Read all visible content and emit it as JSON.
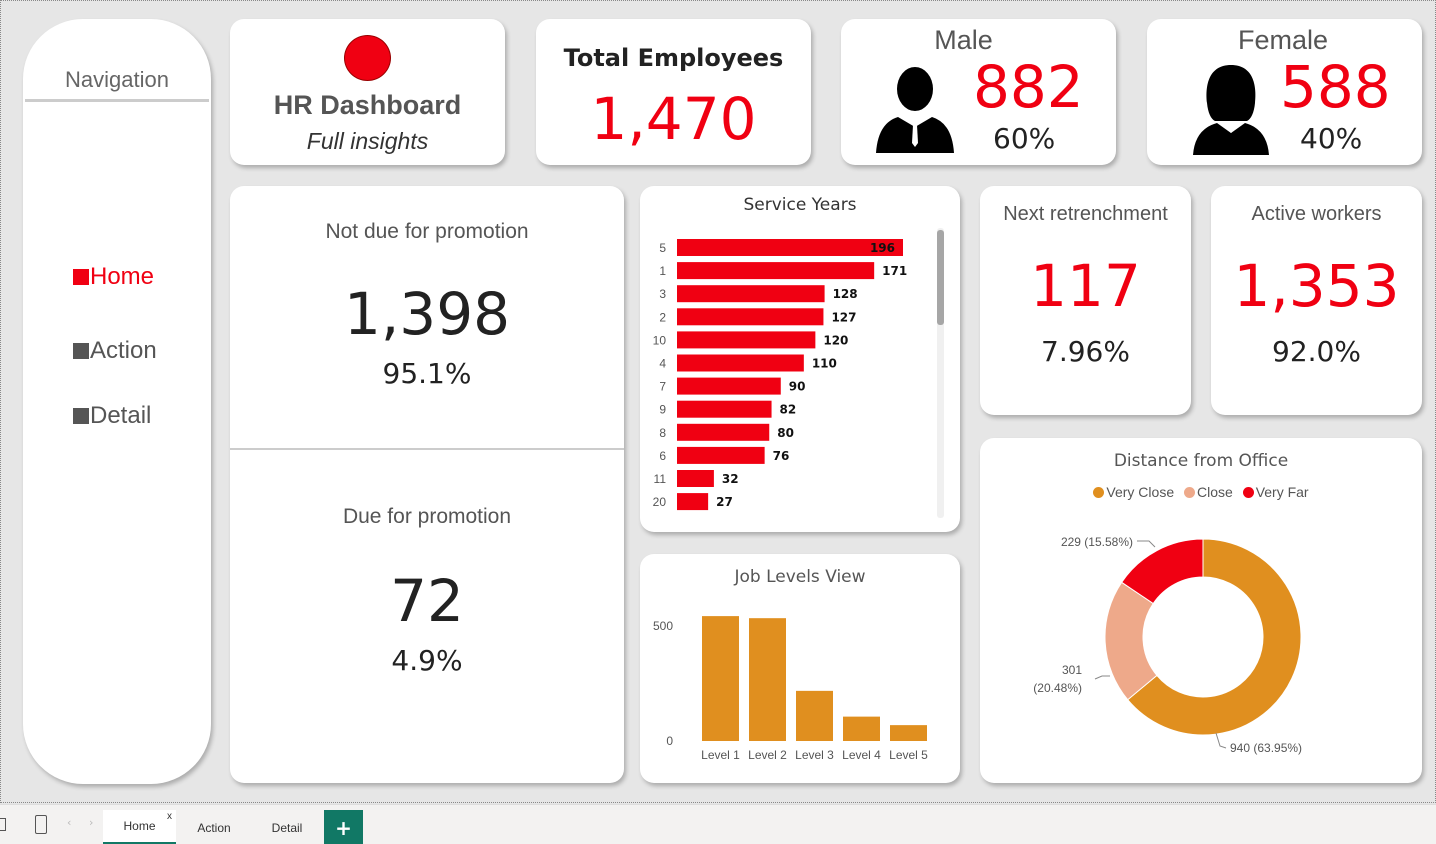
{
  "nav": {
    "title": "Navigation",
    "items": [
      {
        "label": "Home"
      },
      {
        "label": "Action"
      },
      {
        "label": "Detail"
      }
    ]
  },
  "hr": {
    "title": "HR Dashboard",
    "subtitle": "Full insights"
  },
  "total": {
    "title": "Total Employees",
    "value": "1,470"
  },
  "male": {
    "title": "Male",
    "value": "882",
    "pct": "60%"
  },
  "female": {
    "title": "Female",
    "value": "588",
    "pct": "40%"
  },
  "not_due": {
    "title": "Not due for promotion",
    "value": "1,398",
    "pct": "95.1%"
  },
  "due": {
    "title": "Due for promotion",
    "value": "72",
    "pct": "4.9%"
  },
  "retrench": {
    "title": "Next retrenchment",
    "value": "117",
    "pct": "7.96%"
  },
  "active": {
    "title": "Active workers",
    "value": "1,353",
    "pct": "92.0%"
  },
  "colors": {
    "red": "#f00012",
    "orange": "#e08f1f",
    "peach": "#eea98a",
    "teal": "#117865"
  },
  "tabs": [
    {
      "label": "Home",
      "close": "x"
    },
    {
      "label": "Action"
    },
    {
      "label": "Detail"
    }
  ],
  "tab_add": "+",
  "chart_data": [
    {
      "type": "bar",
      "orientation": "horizontal",
      "title": "Service Years",
      "categories": [
        "5",
        "1",
        "3",
        "2",
        "10",
        "4",
        "7",
        "9",
        "8",
        "6",
        "11",
        "20"
      ],
      "values": [
        196,
        171,
        128,
        127,
        120,
        110,
        90,
        82,
        80,
        76,
        32,
        27
      ],
      "color": "#f00012",
      "data_labels": true
    },
    {
      "type": "bar",
      "title": "Job Levels View",
      "categories": [
        "Level 1",
        "Level 2",
        "Level 3",
        "Level 4",
        "Level 5"
      ],
      "values": [
        543,
        534,
        218,
        106,
        69
      ],
      "yticks": [
        "500",
        "0"
      ],
      "ylim": [
        0,
        560
      ],
      "color": "#e08f1f"
    },
    {
      "type": "pie",
      "donut": true,
      "title": "Distance from Office",
      "legend": [
        "Very Close",
        "Close",
        "Very Far"
      ],
      "legend_position": "top",
      "values": [
        940,
        301,
        229
      ],
      "colors": [
        "#e08f1f",
        "#eea98a",
        "#f00012"
      ],
      "labels": [
        "940 (63.95%)",
        "301",
        "(20.48%)",
        "229 (15.58%)"
      ]
    }
  ]
}
